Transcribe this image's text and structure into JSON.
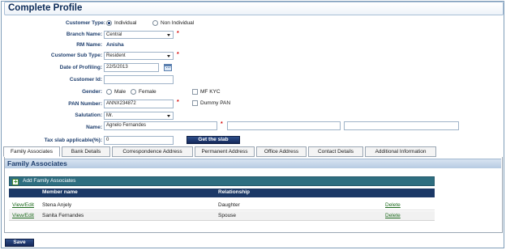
{
  "page": {
    "title": "Complete Profile"
  },
  "form": {
    "customer_type": {
      "label": "Customer Type:",
      "options": [
        "Individual",
        "Non Individual"
      ],
      "selected": "Individual"
    },
    "branch_name": {
      "label": "Branch Name:",
      "value": "Central"
    },
    "rm_name": {
      "label": "RM Name:",
      "value": "Anisha"
    },
    "customer_sub_type": {
      "label": "Customer Sub Type:",
      "value": "Resident"
    },
    "date_of_profiling": {
      "label": "Date of Profiling:",
      "value": "22/5/2013"
    },
    "customer_id": {
      "label": "Customer Id:",
      "value": ""
    },
    "gender": {
      "label": "Gender:",
      "options": [
        "Male",
        "Female"
      ],
      "selected": ""
    },
    "mf_kyc": {
      "label": "MF KYC",
      "checked": false
    },
    "pan_number": {
      "label": "PAN Number:",
      "value": "ANNX234872"
    },
    "dummy_pan": {
      "label": "Dummy PAN",
      "checked": false
    },
    "salutation": {
      "label": "Salutation:",
      "value": "Mr."
    },
    "name": {
      "label": "Name:",
      "first": "Agnelo Fernandes",
      "middle": "",
      "last": ""
    },
    "tax_slab": {
      "label": "Tax slab applicable(%):",
      "value": "0"
    },
    "get_slab_label": "Get the slab",
    "required_mark": "*"
  },
  "tabs": [
    {
      "label": "Family Associates",
      "active": true
    },
    {
      "label": "Bank Details",
      "active": false
    },
    {
      "label": "Correspondence Address",
      "active": false
    },
    {
      "label": "Permanent Address",
      "active": false
    },
    {
      "label": "Office Address",
      "active": false
    },
    {
      "label": "Contact Details",
      "active": false
    },
    {
      "label": "Additional Information",
      "active": false
    }
  ],
  "family": {
    "heading": "Family Associates",
    "add_label": "Add Family Associates",
    "columns": [
      "",
      "Member name",
      "Relationship",
      ""
    ],
    "rows": [
      {
        "view_edit": "View/Edit",
        "member": "Stena Anjely",
        "relationship": "Daughter",
        "delete": "Delete"
      },
      {
        "view_edit": "View/Edit",
        "member": "Sanita Fernandes",
        "relationship": "Spouse",
        "delete": "Delete"
      }
    ]
  },
  "footer": {
    "save_label": "Save"
  },
  "colors": {
    "accent": "#1b3866",
    "grid_bar": "#2e6e80",
    "required": "#d40000",
    "link": "#1f6b1f"
  }
}
